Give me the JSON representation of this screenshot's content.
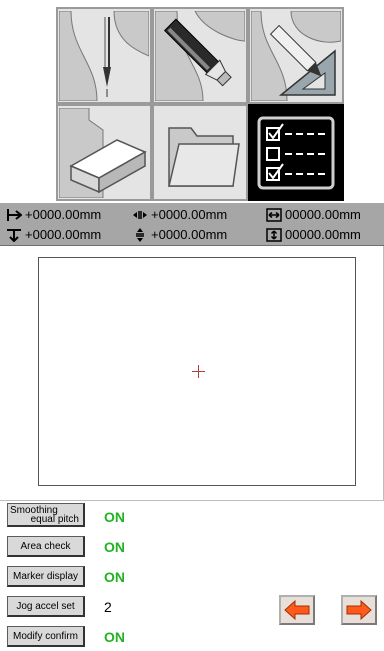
{
  "menu": {
    "tiles": [
      {
        "icon": "needle-plotting-icon"
      },
      {
        "icon": "marker-pen-icon"
      },
      {
        "icon": "drafting-pen-triangle-icon"
      },
      {
        "icon": "eraser-block-icon"
      },
      {
        "icon": "folder-icon"
      },
      {
        "icon": "checklist-settings-icon",
        "active": true
      }
    ]
  },
  "coords": {
    "row1": [
      "+0000.00mm",
      "+0000.00mm",
      "00000.00mm"
    ],
    "row2": [
      "+0000.00mm",
      "+0000.00mm",
      "00000.00mm"
    ]
  },
  "settings": {
    "smoothing_label_1": "Smoothing",
    "smoothing_label_2": "equal pitch",
    "smoothing_value": "ON",
    "area_check_label": "Area check",
    "area_check_value": "ON",
    "marker_display_label": "Marker display",
    "marker_display_value": "ON",
    "jog_accel_label": "Jog accel set",
    "jog_accel_value": "2",
    "modify_confirm_label": "Modify confirm",
    "modify_confirm_value": "ON"
  },
  "colors": {
    "on_value": "#22b222",
    "arrow_fill": "#ff5a1e",
    "active_tile": "#000000"
  },
  "nav": {
    "prev_icon": "arrow-left-icon",
    "next_icon": "arrow-right-icon"
  }
}
